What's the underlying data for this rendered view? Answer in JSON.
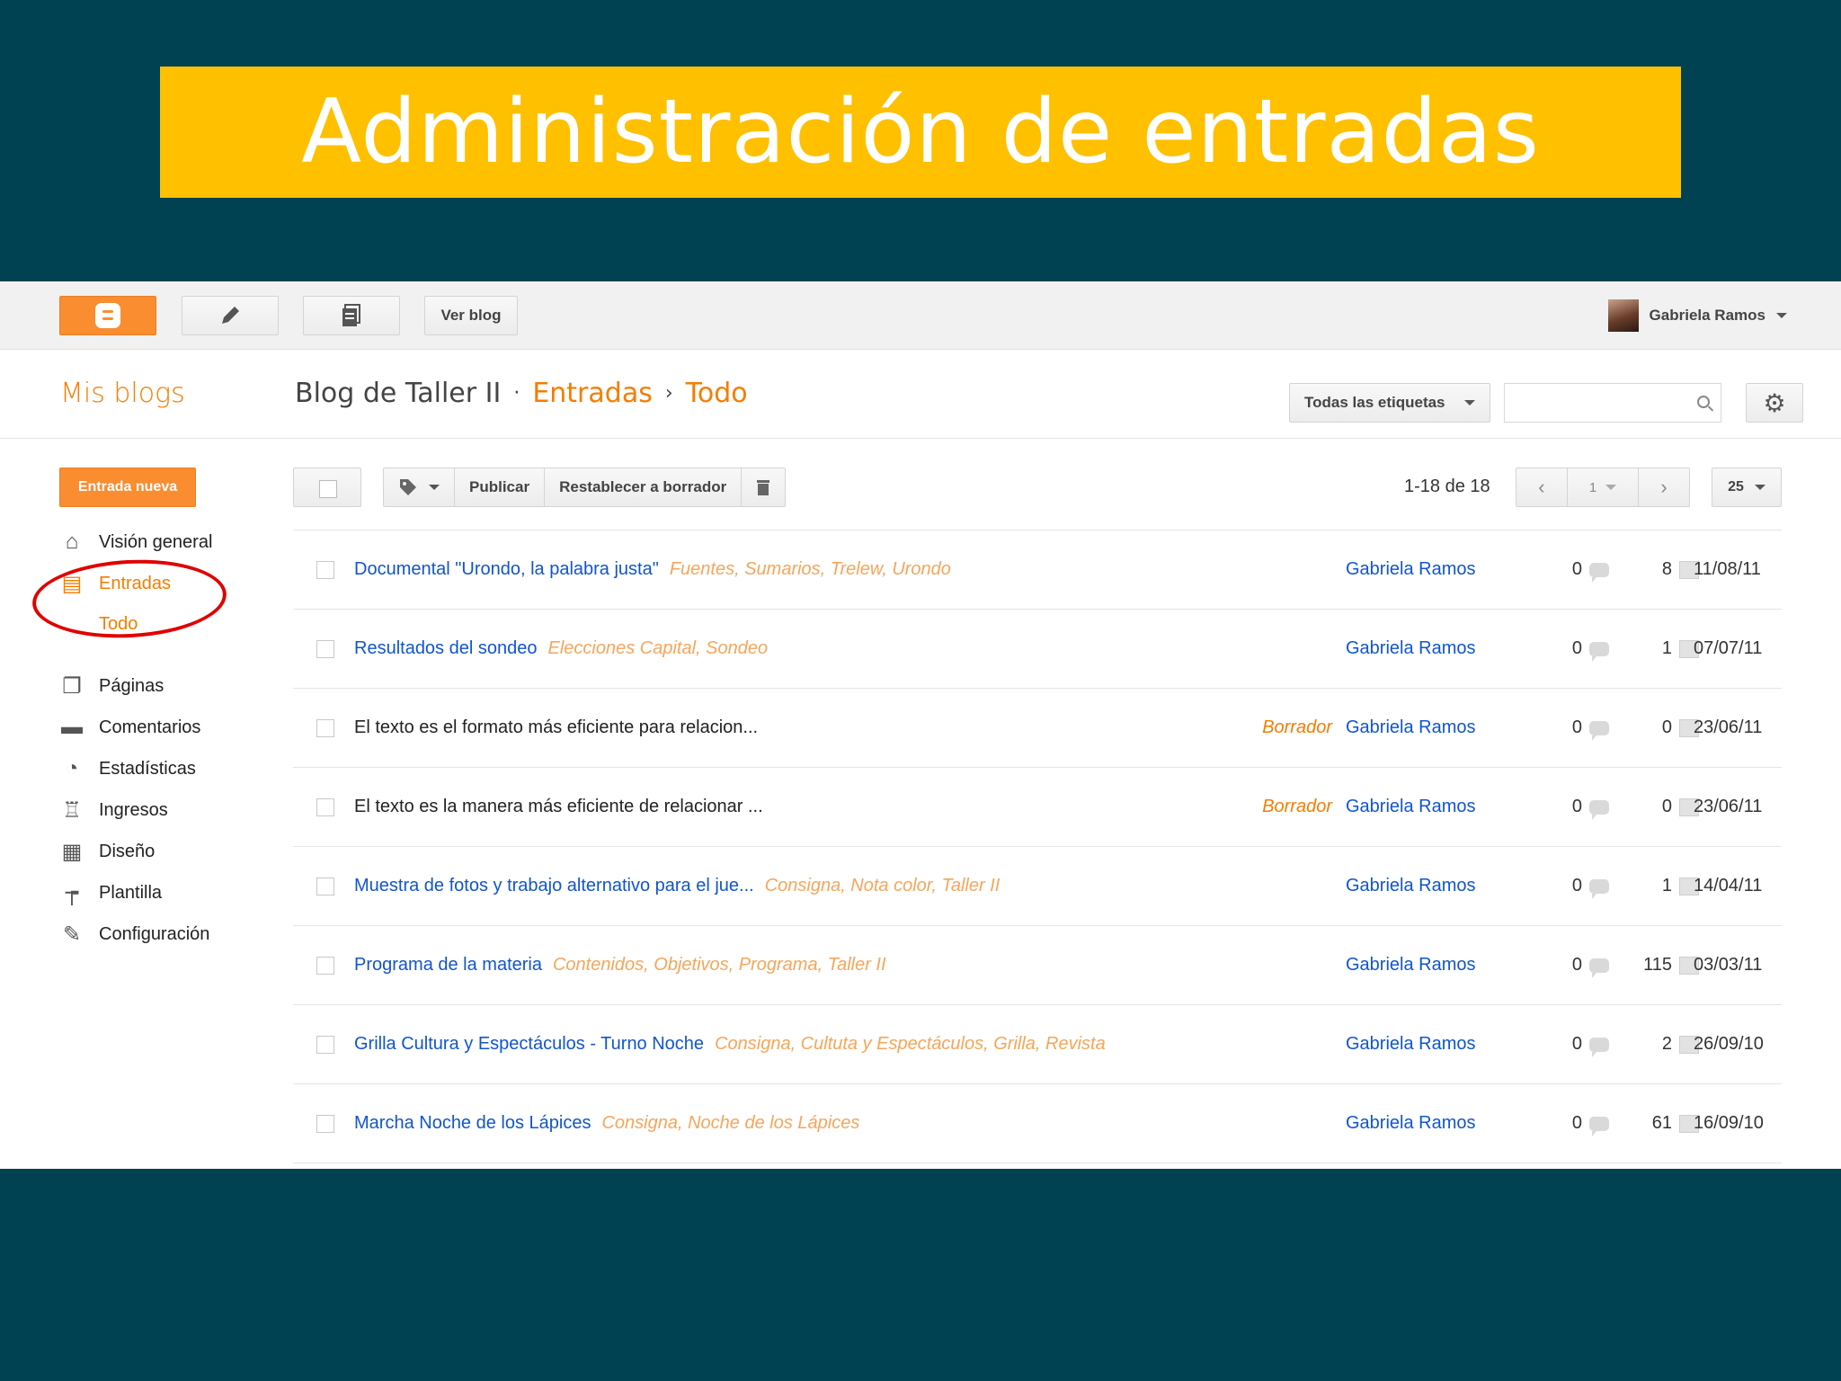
{
  "slide": {
    "title": "Administración de entradas"
  },
  "topbar": {
    "ver_blog": "Ver blog",
    "user_name": "Gabriela Ramos"
  },
  "subbar": {
    "mis_blogs": "Mis blogs",
    "blog_name": "Blog de Taller II",
    "sep1": "·",
    "section": "Entradas",
    "sep2": "›",
    "filter": "Todo",
    "tags_select": "Todas las etiquetas"
  },
  "sidebar": {
    "new_post": "Entrada nueva",
    "items": [
      {
        "label": "Visión general",
        "icon": "home-icon",
        "glyph": "⌂"
      },
      {
        "label": "Entradas",
        "icon": "posts-icon",
        "glyph": "▤"
      },
      {
        "label": "Todo"
      },
      {
        "label": "Páginas",
        "icon": "pages-icon",
        "glyph": "❐"
      },
      {
        "label": "Comentarios",
        "icon": "comment-icon",
        "glyph": "▬"
      },
      {
        "label": "Estadísticas",
        "icon": "pie-chart-icon",
        "glyph": "◔"
      },
      {
        "label": "Ingresos",
        "icon": "trophy-icon",
        "glyph": "♖"
      },
      {
        "label": "Diseño",
        "icon": "layout-icon",
        "glyph": "▦"
      },
      {
        "label": "Plantilla",
        "icon": "paint-roller-icon",
        "glyph": "┮"
      },
      {
        "label": "Configuración",
        "icon": "wrench-icon",
        "glyph": "✎"
      }
    ]
  },
  "actions": {
    "publicar": "Publicar",
    "restablecer": "Restablecer a borrador",
    "count": "1-18 de 18",
    "page": "1",
    "per_page": "25"
  },
  "posts": [
    {
      "title": "Documental \"Urondo, la palabra justa\"",
      "labels": "Fuentes, Sumarios, Trelew, Urondo",
      "status": "",
      "author": "Gabriela Ramos",
      "comments": "0",
      "views": "8",
      "date": "11/08/11"
    },
    {
      "title": "Resultados del sondeo",
      "labels": "Elecciones Capital, Sondeo",
      "status": "",
      "author": "Gabriela Ramos",
      "comments": "0",
      "views": "1",
      "date": "07/07/11"
    },
    {
      "title": "El texto es el formato más eficiente para relacion...",
      "labels": "",
      "status": "Borrador",
      "author": "Gabriela Ramos",
      "comments": "0",
      "views": "0",
      "date": "23/06/11"
    },
    {
      "title": "El texto es la manera más eficiente de relacionar ...",
      "labels": "",
      "status": "Borrador",
      "author": "Gabriela Ramos",
      "comments": "0",
      "views": "0",
      "date": "23/06/11"
    },
    {
      "title": "Muestra de fotos y trabajo alternativo para el jue...",
      "labels": "Consigna, Nota color, Taller II",
      "status": "",
      "author": "Gabriela Ramos",
      "comments": "0",
      "views": "1",
      "date": "14/04/11"
    },
    {
      "title": "Programa de la materia",
      "labels": "Contenidos, Objetivos, Programa, Taller II",
      "status": "",
      "author": "Gabriela Ramos",
      "comments": "0",
      "views": "115",
      "date": "03/03/11"
    },
    {
      "title": "Grilla Cultura y Espectáculos - Turno Noche",
      "labels": "Consigna, Cultuta y Espectáculos, Grilla, Revista",
      "status": "",
      "author": "Gabriela Ramos",
      "comments": "0",
      "views": "2",
      "date": "26/09/10"
    },
    {
      "title": "Marcha Noche de los Lápices",
      "labels": "Consigna, Noche de los Lápices",
      "status": "",
      "author": "Gabriela Ramos",
      "comments": "0",
      "views": "61",
      "date": "16/09/10"
    }
  ]
}
